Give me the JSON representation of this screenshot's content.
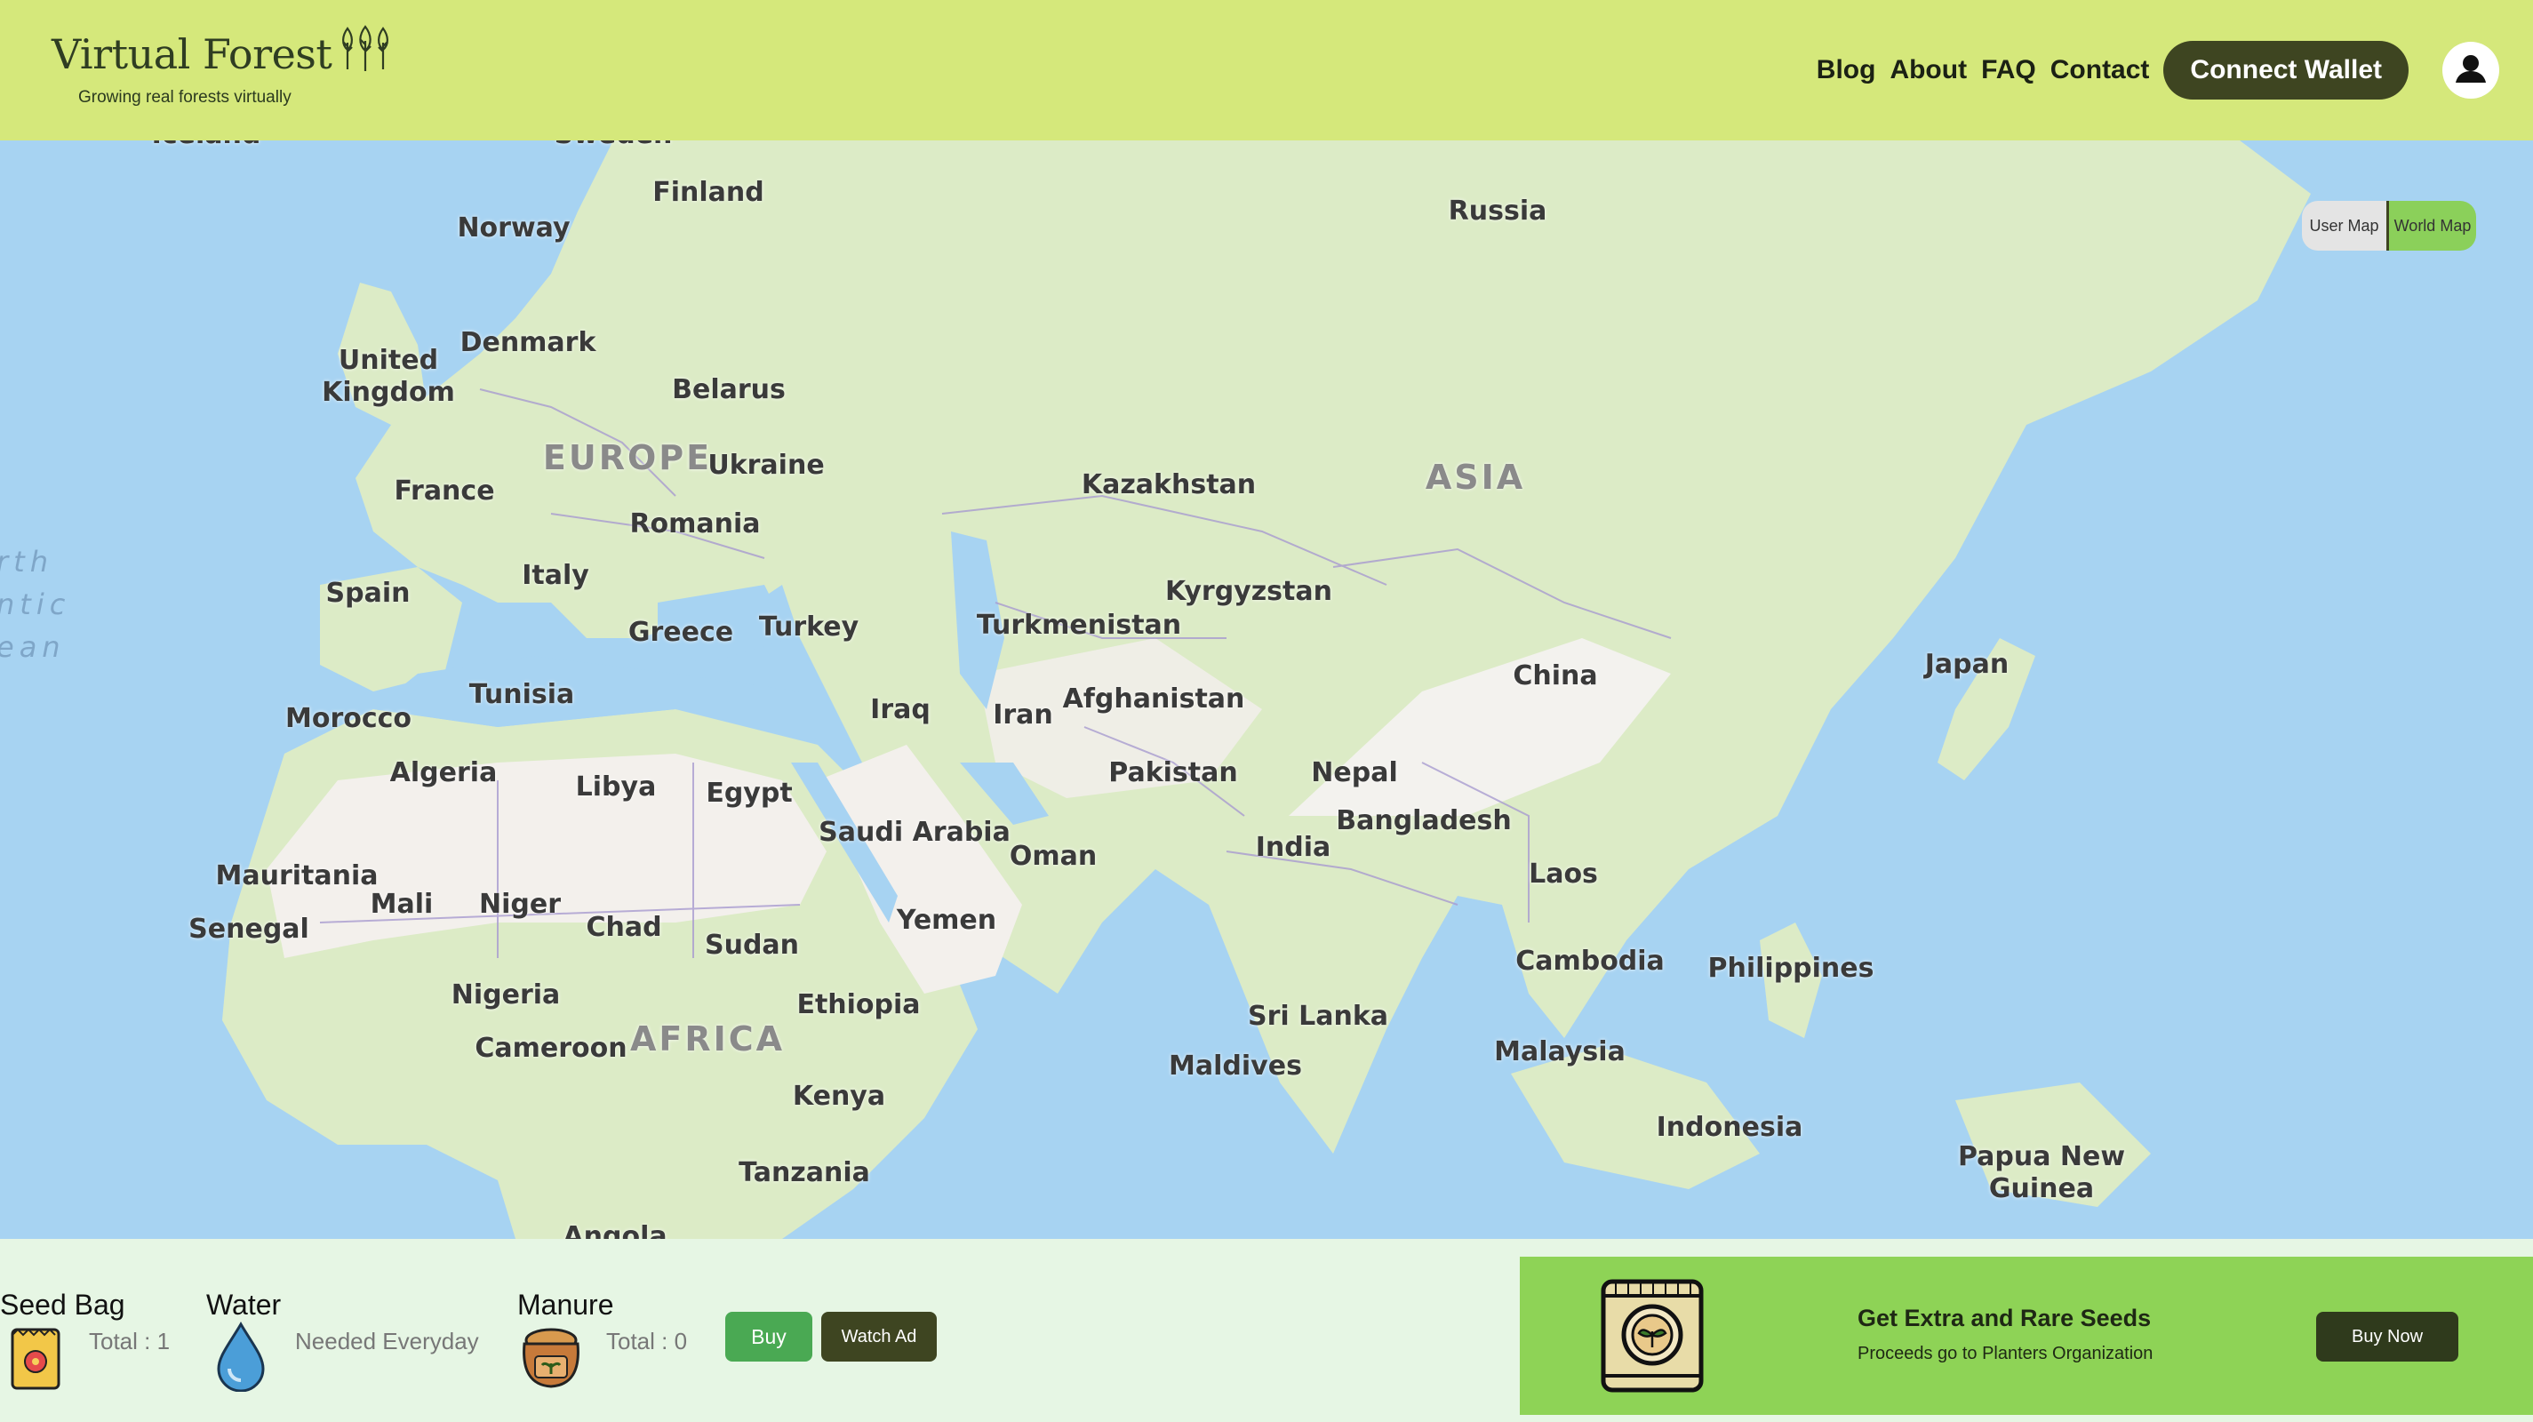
{
  "header": {
    "title": "Virtual Forest",
    "tagline": "Growing real forests virtually",
    "nav": [
      "Blog",
      "About",
      "FAQ",
      "Contact"
    ],
    "connect_label": "Connect Wallet",
    "colors": {
      "bar": "#d5e87b",
      "dark": "#3e4521"
    }
  },
  "map": {
    "toggle": {
      "user": "User Map",
      "world": "World Map",
      "active": "world"
    },
    "labels": {
      "iceland": "Iceland",
      "sweden": "Sweden",
      "finland": "Finland",
      "norway": "Norway",
      "russia": "Russia",
      "uk": "United Kingdom",
      "denmark": "Denmark",
      "belarus": "Belarus",
      "europe": "EUROPE",
      "ukraine": "Ukraine",
      "kazakhstan": "Kazakhstan",
      "asia": "ASIA",
      "france": "France",
      "romania": "Romania",
      "italy": "Italy",
      "spain": "Spain",
      "kyrgyzstan": "Kyrgyzstan",
      "greece": "Greece",
      "turkey": "Turkey",
      "turkmenistan": "Turkmenistan",
      "japan": "Japan",
      "china": "China",
      "tunisia": "Tunisia",
      "morocco": "Morocco",
      "iraq": "Iraq",
      "iran": "Iran",
      "afghanistan": "Afghanistan",
      "algeria": "Algeria",
      "libya": "Libya",
      "egypt": "Egypt",
      "pakistan": "Pakistan",
      "nepal": "Nepal",
      "bangladesh": "Bangladesh",
      "saudi": "Saudi Arabia",
      "oman": "Oman",
      "india": "India",
      "mauritania": "Mauritania",
      "mali": "Mali",
      "niger": "Niger",
      "laos": "Laos",
      "senegal": "Senegal",
      "chad": "Chad",
      "yemen": "Yemen",
      "sudan": "Sudan",
      "cambodia": "Cambodia",
      "philippines": "Philippines",
      "nigeria": "Nigeria",
      "ethiopia": "Ethiopia",
      "srilanka": "Sri Lanka",
      "cameroon": "Cameroon",
      "africa": "AFRICA",
      "malaysia": "Malaysia",
      "maldives": "Maldives",
      "kenya": "Kenya",
      "indonesia": "Indonesia",
      "png": "Papua New Guinea",
      "tanzania": "Tanzania",
      "angola": "Angola",
      "ocean": "rth ntic ean"
    },
    "colors": {
      "water": "#a7d3f2",
      "land": "#dcebc6",
      "desert": "#f3f0ec",
      "border": "#a89bd0"
    }
  },
  "inventory": {
    "seed": {
      "title": "Seed Bag",
      "value": "Total : 1",
      "icon": "seed-bag-icon"
    },
    "water": {
      "title": "Water",
      "value": "Needed Everyday",
      "icon": "water-drop-icon"
    },
    "manure": {
      "title": "Manure",
      "value": "Total : 0",
      "icon": "manure-bag-icon"
    },
    "buy_label": "Buy",
    "ad_label": "Watch Ad"
  },
  "promo": {
    "title": "Get Extra and Rare Seeds",
    "subtitle": "Proceeds go to Planters Organization",
    "button": "Buy Now",
    "icon": "seed-packet-icon"
  }
}
